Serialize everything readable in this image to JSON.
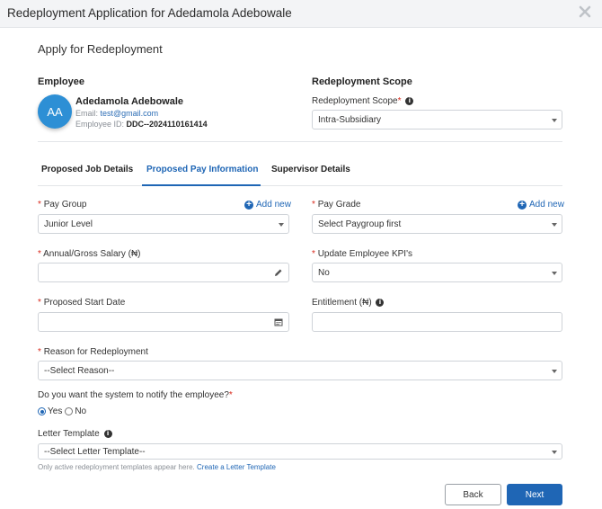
{
  "window": {
    "title": "Redeployment Application for Adedamola Adebowale"
  },
  "heading": "Apply for Redeployment",
  "employee": {
    "section_label": "Employee",
    "initials": "AA",
    "name": "Adedamola Adebowale",
    "email_label": "Email:",
    "email": "test@gmail.com",
    "id_label": "Employee ID:",
    "id": "DDC--2024110161414",
    "avatar_color": "#2d8fd5"
  },
  "scope": {
    "section_label": "Redeployment Scope",
    "field_label": "Redeployment Scope",
    "value": "Intra-Subsidiary"
  },
  "tabs": [
    {
      "label": "Proposed Job Details",
      "active": false
    },
    {
      "label": "Proposed Pay Information",
      "active": true
    },
    {
      "label": "Supervisor Details",
      "active": false
    }
  ],
  "form": {
    "pay_group": {
      "label": "Pay Group",
      "value": "Junior Level",
      "add_new": "Add new"
    },
    "pay_grade": {
      "label": "Pay Grade",
      "value": "Select Paygroup first",
      "add_new": "Add new"
    },
    "salary": {
      "label": "Annual/Gross Salary (₦)",
      "value": ""
    },
    "update_kpi": {
      "label": "Update Employee KPI's",
      "value": "No"
    },
    "start_date": {
      "label": "Proposed Start Date",
      "value": ""
    },
    "entitlement": {
      "label": "Entitlement (₦)",
      "value": ""
    },
    "reason": {
      "label": "Reason for Redeployment",
      "value": "--Select Reason--"
    },
    "notify": {
      "question": "Do you want the system to notify the employee?",
      "yes": "Yes",
      "no": "No",
      "selected": "Yes"
    },
    "letter_template": {
      "label": "Letter Template",
      "value": "--Select Letter Template--",
      "hint": "Only active redeployment templates appear here.",
      "hint_link": "Create a Letter Template"
    }
  },
  "buttons": {
    "back": "Back",
    "next": "Next"
  },
  "colors": {
    "accent": "#1f66b5",
    "required": "#d9291c"
  },
  "icons": [
    "close-icon",
    "info-icon",
    "plus-circle-icon",
    "pencil-icon",
    "calendar-icon",
    "chevron-down-icon"
  ]
}
